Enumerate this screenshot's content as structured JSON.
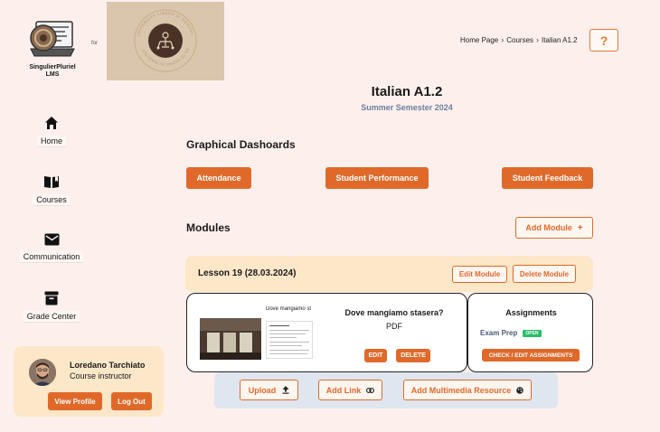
{
  "brand": {
    "logo_caption_line1": "SingulierPluriel",
    "logo_caption_line2": "LMS",
    "for_text": "for",
    "university_seal_text": "UNIVERSITÀ LIBERA DI GENOVA"
  },
  "breadcrumb": {
    "items": [
      "Home Page",
      "Courses",
      "Italian A1.2"
    ]
  },
  "help": {
    "label": "?"
  },
  "course": {
    "title": "Italian A1.2",
    "subtitle": "Summer Semester 2024"
  },
  "sidebar": {
    "items": [
      {
        "label": "Home",
        "icon": "home-icon"
      },
      {
        "label": "Courses",
        "icon": "book-icon"
      },
      {
        "label": "Communication",
        "icon": "mail-icon"
      },
      {
        "label": "Grade Center",
        "icon": "archive-icon"
      }
    ]
  },
  "profile": {
    "name": "Loredano Tarchiato",
    "role": "Course instructor",
    "view_label": "View Profile",
    "logout_label": "Log Out"
  },
  "dashboards": {
    "title": "Graphical Dashoards",
    "buttons": [
      "Attendance",
      "Student Performance",
      "Student Feedback"
    ]
  },
  "modules": {
    "title": "Modules",
    "add_label": "Add Module",
    "add_icon": "+"
  },
  "lesson": {
    "title": "Lesson 19 (28.03.2024)",
    "edit_label": "Edit Module",
    "delete_label": "Delete Module",
    "resource": {
      "preview_title": "Dove mangiamo st",
      "name": "Dove mangiamo stasera?",
      "type": "PDF",
      "edit_label": "EDIT",
      "delete_label": "DELETE"
    },
    "assignments": {
      "title": "Assignments",
      "item_label": "Exam Prep",
      "item_status": "OPEN",
      "action_label": "CHECK / EDIT ASSIGNMENTS"
    }
  },
  "uploads": {
    "upload_label": "Upload",
    "link_label": "Add Link",
    "multimedia_label": "Add Multimedia Resource"
  },
  "colors": {
    "accent": "#e0692a",
    "background": "#fdf0ec",
    "panel": "#fce7c8",
    "subtitle": "#6b7f9f",
    "status_open": "#2bbd6a"
  }
}
